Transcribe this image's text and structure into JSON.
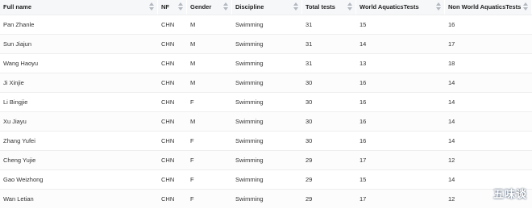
{
  "columns": [
    "Full name",
    "NF",
    "Gender",
    "Discipline",
    "Total tests",
    "World AquaticsTests",
    "Non World AquaticsTests"
  ],
  "rows": [
    [
      "Pan Zhanle",
      "CHN",
      "M",
      "Swimming",
      "31",
      "15",
      "16"
    ],
    [
      "Sun Jiajun",
      "CHN",
      "M",
      "Swimming",
      "31",
      "14",
      "17"
    ],
    [
      "Wang Haoyu",
      "CHN",
      "M",
      "Swimming",
      "31",
      "13",
      "18"
    ],
    [
      "Ji Xinjie",
      "CHN",
      "M",
      "Swimming",
      "30",
      "16",
      "14"
    ],
    [
      "Li Bingjie",
      "CHN",
      "F",
      "Swimming",
      "30",
      "16",
      "14"
    ],
    [
      "Xu Jiayu",
      "CHN",
      "M",
      "Swimming",
      "30",
      "16",
      "14"
    ],
    [
      "Zhang Yufei",
      "CHN",
      "F",
      "Swimming",
      "30",
      "16",
      "14"
    ],
    [
      "Cheng Yujie",
      "CHN",
      "F",
      "Swimming",
      "29",
      "17",
      "12"
    ],
    [
      "Gao Weizhong",
      "CHN",
      "F",
      "Swimming",
      "29",
      "15",
      "14"
    ],
    [
      "Wan Letian",
      "CHN",
      "F",
      "Swimming",
      "29",
      "17",
      "12"
    ]
  ],
  "watermark": "五味谈"
}
